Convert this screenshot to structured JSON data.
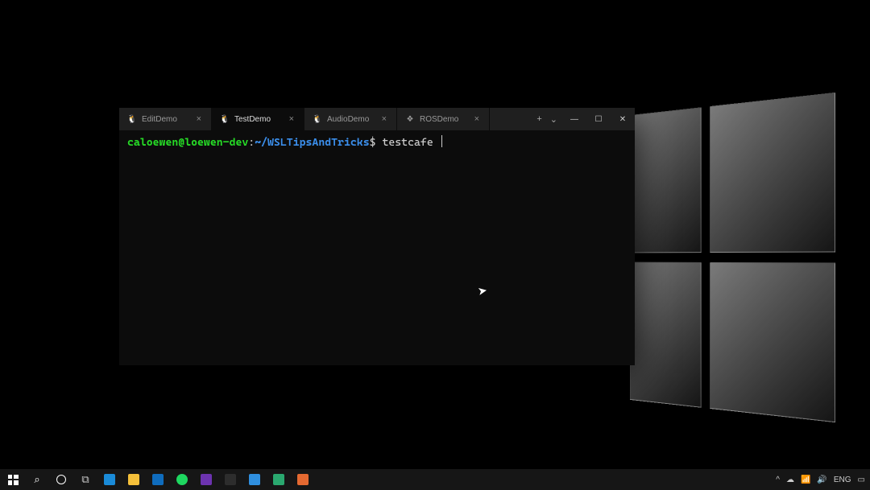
{
  "terminal": {
    "tabs": [
      {
        "label": "EditDemo",
        "icon": "tux",
        "active": false
      },
      {
        "label": "TestDemo",
        "icon": "tux",
        "active": true
      },
      {
        "label": "AudioDemo",
        "icon": "tux",
        "active": false
      },
      {
        "label": "ROSDemo",
        "icon": "windows",
        "active": false
      }
    ],
    "prompt": {
      "user_host": "caloewen@loewen-dev",
      "separator": ":",
      "path": "~/WSLTipsAndTricks",
      "symbol": "$",
      "command": "testcafe "
    },
    "tab_controls": {
      "new": "+",
      "dropdown": "⌄"
    },
    "window_controls": {
      "minimize": "—",
      "maximize": "☐",
      "close": "✕"
    }
  },
  "taskbar": {
    "left_items": [
      {
        "name": "start-button",
        "kind": "start"
      },
      {
        "name": "search-icon",
        "kind": "glyph",
        "glyph": "⌕",
        "color": "#fff"
      },
      {
        "name": "cortana-icon",
        "kind": "ring"
      },
      {
        "name": "task-view-icon",
        "kind": "glyph",
        "glyph": "⧉",
        "color": "#ccc"
      },
      {
        "name": "edge-icon",
        "kind": "square",
        "color": "#1a8bd8"
      },
      {
        "name": "explorer-icon",
        "kind": "square",
        "color": "#f5c03a"
      },
      {
        "name": "outlook-icon",
        "kind": "square",
        "color": "#0f6cbd"
      },
      {
        "name": "spotify-icon",
        "kind": "circle",
        "color": "#1ed760"
      },
      {
        "name": "vs-icon",
        "kind": "square",
        "color": "#6c33af"
      },
      {
        "name": "terminal-icon",
        "kind": "square",
        "color": "#2d2d2d"
      },
      {
        "name": "vscode-icon",
        "kind": "square",
        "color": "#2f8fdf"
      },
      {
        "name": "app1-icon",
        "kind": "square",
        "color": "#2aa86f"
      },
      {
        "name": "app2-icon",
        "kind": "square",
        "color": "#e46931"
      }
    ],
    "tray": {
      "chevron": "^",
      "icons": [
        "cloud",
        "wifi",
        "volume"
      ],
      "lang": "ENG",
      "notifications": "notif"
    }
  }
}
